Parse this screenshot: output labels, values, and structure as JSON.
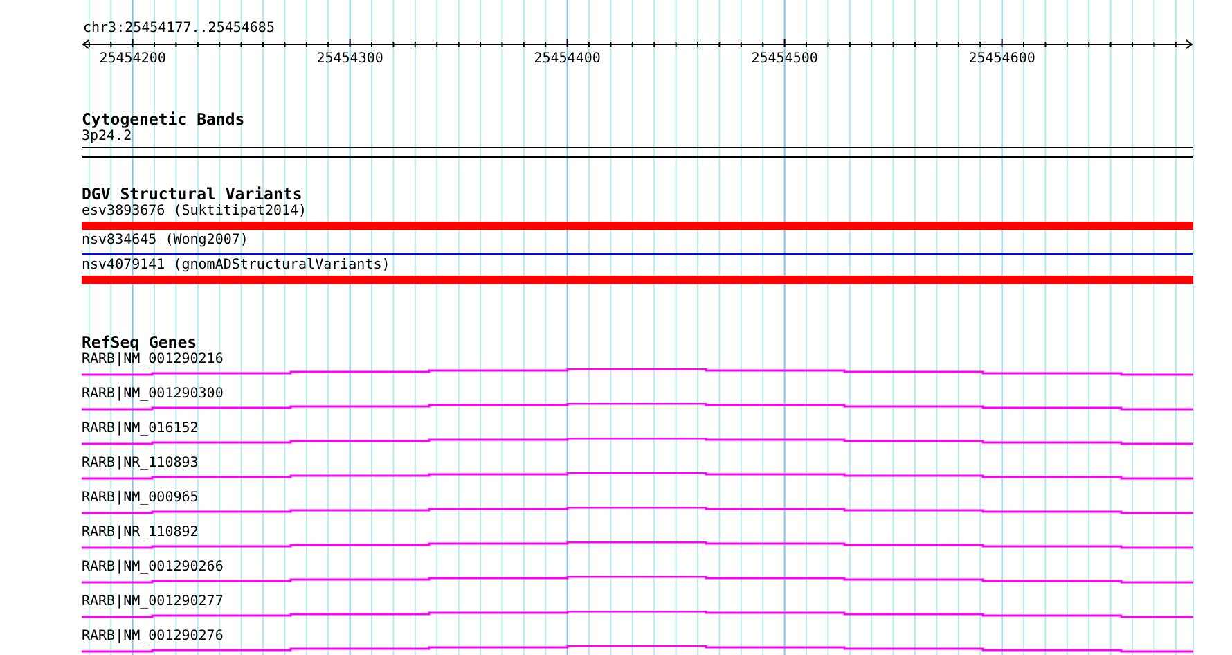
{
  "ruler": {
    "location": "chr3:25454177..25454685",
    "ticks": [
      "25454200",
      "25454300",
      "25454400",
      "25454500",
      "25454600"
    ]
  },
  "tracks": [
    {
      "kind": "bands",
      "title": "Cytogenetic Bands",
      "features": [
        {
          "label": "3p24.2"
        }
      ]
    },
    {
      "kind": "variants",
      "title": "DGV Structural Variants",
      "features": [
        {
          "label": "esv3893676 (Suktitipat2014)",
          "kind": "bar",
          "color": "#ff0000"
        },
        {
          "label": "nsv834645 (Wong2007)",
          "kind": "line",
          "color": "#0000ff"
        },
        {
          "label": "nsv4079141 (gnomADStructuralVariants)",
          "kind": "bar",
          "color": "#ff0000"
        }
      ]
    },
    {
      "kind": "genes",
      "title": "RefSeq Genes",
      "features": [
        {
          "label": "RARB|NM_001290216"
        },
        {
          "label": "RARB|NM_001290300"
        },
        {
          "label": "RARB|NM_016152"
        },
        {
          "label": "RARB|NR_110893"
        },
        {
          "label": "RARB|NM_000965"
        },
        {
          "label": "RARB|NR_110892"
        },
        {
          "label": "RARB|NM_001290266"
        },
        {
          "label": "RARB|NM_001290277"
        },
        {
          "label": "RARB|NM_001290276"
        }
      ]
    }
  ]
}
